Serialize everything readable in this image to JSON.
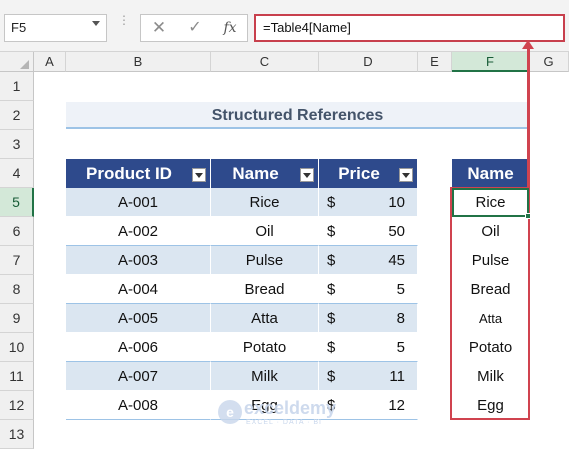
{
  "formula_bar": {
    "name_box": "F5",
    "cancel_icon": "✕",
    "enter_icon": "✓",
    "fx_icon": "fx",
    "formula": "=Table4[Name]"
  },
  "columns": [
    "A",
    "B",
    "C",
    "D",
    "E",
    "F",
    "G"
  ],
  "rows": [
    "1",
    "2",
    "3",
    "4",
    "5",
    "6",
    "7",
    "8",
    "9",
    "10",
    "11",
    "12",
    "13"
  ],
  "selected": {
    "column": "F",
    "row": "5"
  },
  "title": "Structured References",
  "table": {
    "headers": [
      "Product ID",
      "Name",
      "Price"
    ],
    "rows": [
      {
        "id": "A-001",
        "name": "Rice",
        "currency": "$",
        "price": "10"
      },
      {
        "id": "A-002",
        "name": "Oil",
        "currency": "$",
        "price": "50"
      },
      {
        "id": "A-003",
        "name": "Pulse",
        "currency": "$",
        "price": "45"
      },
      {
        "id": "A-004",
        "name": "Bread",
        "currency": "$",
        "price": "5"
      },
      {
        "id": "A-005",
        "name": "Atta",
        "currency": "$",
        "price": "8"
      },
      {
        "id": "A-006",
        "name": "Potato",
        "currency": "$",
        "price": "5"
      },
      {
        "id": "A-007",
        "name": "Milk",
        "currency": "$",
        "price": "11"
      },
      {
        "id": "A-008",
        "name": "Egg",
        "currency": "$",
        "price": "12"
      }
    ]
  },
  "result": {
    "header": "Name",
    "values": [
      "Rice",
      "Oil",
      "Pulse",
      "Bread",
      "Atta",
      "Potato",
      "Milk",
      "Egg"
    ]
  },
  "watermark": {
    "logo": "e",
    "name": "exceldemy",
    "tagline": "EXCEL · DATA · BI"
  },
  "colors": {
    "header_fill": "#2e4a8c",
    "band_fill": "#dbe6f1",
    "highlight": "#d0434f",
    "selection": "#217346"
  }
}
